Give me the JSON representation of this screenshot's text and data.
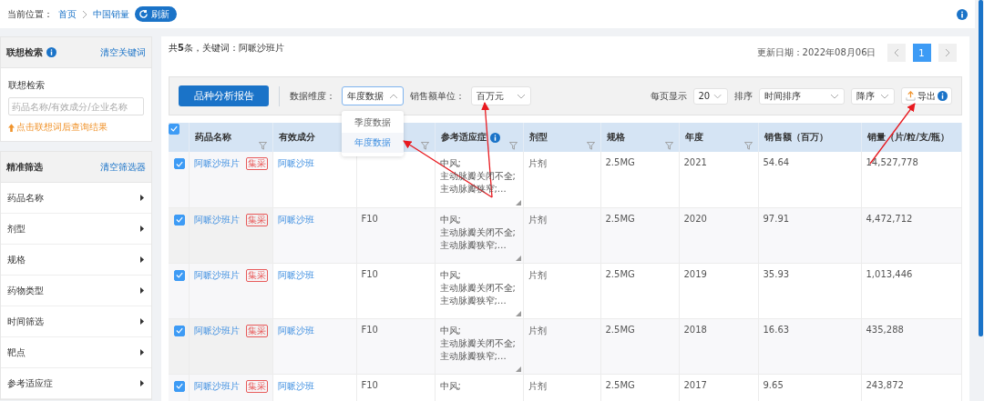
{
  "breadcrumb": {
    "label": "当前位置：",
    "items": [
      {
        "label": "首页"
      },
      {
        "label": "中国销量"
      }
    ],
    "refresh": "刷新"
  },
  "sidebar": {
    "search": {
      "title": "联想检索",
      "clear": "清空关键词",
      "field_label": "联想检索",
      "placeholder": "药品名称/有效成分/企业名称",
      "hint": "点击联想词后查询结果"
    },
    "filters": {
      "title": "精准筛选",
      "clear": "清空筛选器",
      "items": [
        {
          "label": "药品名称"
        },
        {
          "label": "剂型"
        },
        {
          "label": "规格"
        },
        {
          "label": "药物类型"
        },
        {
          "label": "时间筛选"
        },
        {
          "label": "靶点"
        },
        {
          "label": "参考适应症"
        }
      ]
    }
  },
  "summary": "共**5**条，关键词：阿哌沙班片",
  "update_date": "更新日期：2022年08月06日",
  "pagination": {
    "pages": [
      {
        "label": "1",
        "selected": true
      }
    ]
  },
  "toolbar": {
    "report_button": "品种分析报告",
    "dimension": {
      "label": "数据维度：",
      "value": "年度数据",
      "expanded": true,
      "options": [
        {
          "label": "季度数据",
          "selected": false
        },
        {
          "label": "年度数据",
          "selected": true
        }
      ]
    },
    "unit": {
      "label": "销售额单位：",
      "value": "百万元"
    },
    "page_size": {
      "label": "每页显示",
      "value": "20"
    },
    "sort": {
      "label": "排序",
      "field": "时间排序",
      "order": "降序"
    },
    "export": "导出"
  },
  "table": {
    "all_checked": true,
    "columns": [
      {
        "label": "药品名称",
        "filter": true
      },
      {
        "label": "有效成分",
        "filter": false
      },
      {
        "filter": true
      },
      {
        "label": "参考适应症",
        "info": true,
        "filter": true
      },
      {
        "label": "剂型",
        "filter": true
      },
      {
        "label": "规格",
        "filter": true
      },
      {
        "label": "年度",
        "filter": true
      },
      {
        "label": "销售额（百万）",
        "filter": false
      },
      {
        "label": "销量（片/粒/支/瓶）",
        "filter": false
      }
    ],
    "rows": [
      {
        "checked": true,
        "name": "阿哌沙班片",
        "tag": "集采",
        "ingredient": "阿哌沙班",
        "indications": [
          "中风;",
          "主动脉瓣关闭不全;",
          "主动脉瓣狭窄;…"
        ],
        "form": "片剂",
        "spec": "2.5MG",
        "year": "2021",
        "sales": "54.64",
        "volume": "14,527,778"
      },
      {
        "checked": true,
        "name": "阿哌沙班片",
        "tag": "集采",
        "ingredient": "阿哌沙班",
        "column_4": "F10",
        "indications": [
          "中风;",
          "主动脉瓣关闭不全;",
          "主动脉瓣狭窄;…"
        ],
        "form": "片剂",
        "spec": "2.5MG",
        "year": "2020",
        "sales": "97.91",
        "volume": "4,472,712"
      },
      {
        "checked": true,
        "name": "阿哌沙班片",
        "tag": "集采",
        "ingredient": "阿哌沙班",
        "column_4": "F10",
        "indications": [
          "中风;",
          "主动脉瓣关闭不全;",
          "主动脉瓣狭窄;…"
        ],
        "form": "片剂",
        "spec": "2.5MG",
        "year": "2019",
        "sales": "35.93",
        "volume": "1,013,446"
      },
      {
        "checked": true,
        "name": "阿哌沙班片",
        "tag": "集采",
        "ingredient": "阿哌沙班",
        "column_4": "F10",
        "indications": [
          "中风;",
          "主动脉瓣关闭不全;",
          "主动脉瓣狭窄;…"
        ],
        "form": "片剂",
        "spec": "2.5MG",
        "year": "2018",
        "sales": "16.63",
        "volume": "435,288"
      },
      {
        "checked": true,
        "name": "阿哌沙班片",
        "tag": "集采",
        "ingredient": "阿哌沙班",
        "column_4": "F10",
        "indications": [
          "中风;"
        ],
        "form": "片剂",
        "spec": "2.5MG",
        "year": "2017",
        "sales": "9.65",
        "volume": "243,872"
      }
    ]
  }
}
